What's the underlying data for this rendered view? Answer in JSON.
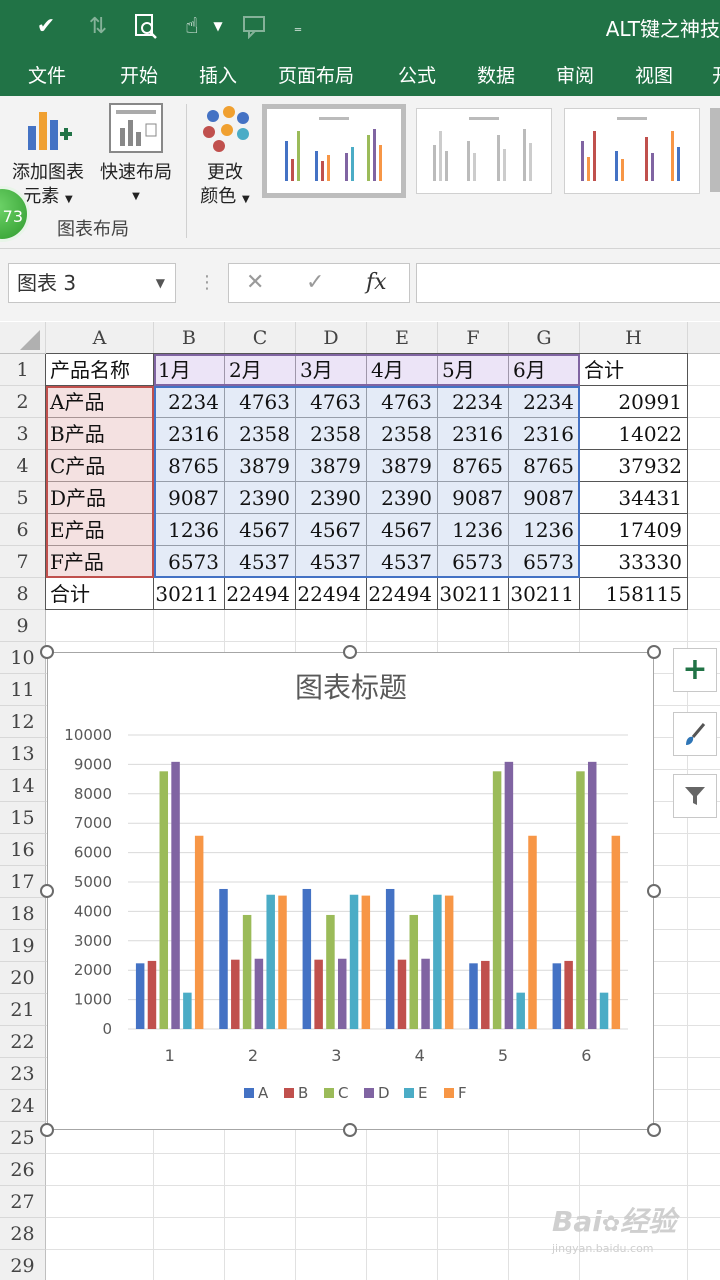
{
  "qat": {
    "title": "ALT键之神技"
  },
  "tabs": [
    "文件",
    "开始",
    "插入",
    "页面布局",
    "公式",
    "数据",
    "审阅",
    "视图",
    "开"
  ],
  "ribbon": {
    "add_element_line1": "添加图表",
    "add_element_line2": "元素",
    "quick_layout": "快速布局",
    "change_color_line1": "更改",
    "change_color_line2": "颜色",
    "group_label": "图表布局",
    "badge": "73"
  },
  "formula_bar": {
    "name_box": "图表 3",
    "fx": "fx",
    "cancel": "✕",
    "enter": "✓"
  },
  "sheet": {
    "columns": [
      "A",
      "B",
      "C",
      "D",
      "E",
      "F",
      "G",
      "H"
    ],
    "rows": [
      "1",
      "2",
      "3",
      "4",
      "5",
      "6",
      "7",
      "8",
      "9",
      "10",
      "11",
      "12",
      "13",
      "14",
      "15",
      "16",
      "17",
      "18",
      "19",
      "20",
      "21",
      "22",
      "23",
      "24",
      "25",
      "26",
      "27",
      "28",
      "29"
    ],
    "header_row": [
      "产品名称",
      "1月",
      "2月",
      "3月",
      "4月",
      "5月",
      "6月",
      "合计"
    ],
    "data_rows": [
      [
        "A产品",
        "2234",
        "4763",
        "4763",
        "4763",
        "2234",
        "2234",
        "20991"
      ],
      [
        "B产品",
        "2316",
        "2358",
        "2358",
        "2358",
        "2316",
        "2316",
        "14022"
      ],
      [
        "C产品",
        "8765",
        "3879",
        "3879",
        "3879",
        "8765",
        "8765",
        "37932"
      ],
      [
        "D产品",
        "9087",
        "2390",
        "2390",
        "2390",
        "9087",
        "9087",
        "34431"
      ],
      [
        "E产品",
        "1236",
        "4567",
        "4567",
        "4567",
        "1236",
        "1236",
        "17409"
      ],
      [
        "F产品",
        "6573",
        "4537",
        "4537",
        "4537",
        "6573",
        "6573",
        "33330"
      ]
    ],
    "total_row": [
      "合计",
      "30211",
      "22494",
      "22494",
      "22494",
      "30211",
      "30211",
      "158115"
    ]
  },
  "chart_data": {
    "type": "bar",
    "title": "图表标题",
    "categories": [
      "1",
      "2",
      "3",
      "4",
      "5",
      "6"
    ],
    "ylim": [
      0,
      10000
    ],
    "yticks": [
      "10000",
      "9000",
      "8000",
      "7000",
      "6000",
      "5000",
      "4000",
      "3000",
      "2000",
      "1000",
      "0"
    ],
    "grid": true,
    "legend": "bottom",
    "series": [
      {
        "name": "A",
        "color": "#4472c4",
        "values": [
          2234,
          4763,
          4763,
          4763,
          2234,
          2234
        ]
      },
      {
        "name": "B",
        "color": "#c0504d",
        "values": [
          2316,
          2358,
          2358,
          2358,
          2316,
          2316
        ]
      },
      {
        "name": "C",
        "color": "#9bbb59",
        "values": [
          8765,
          3879,
          3879,
          3879,
          8765,
          8765
        ]
      },
      {
        "name": "D",
        "color": "#8064a2",
        "values": [
          9087,
          2390,
          2390,
          2390,
          9087,
          9087
        ]
      },
      {
        "name": "E",
        "color": "#4bacc6",
        "values": [
          1236,
          4567,
          4567,
          4567,
          1236,
          1236
        ]
      },
      {
        "name": "F",
        "color": "#f79646",
        "values": [
          6573,
          4537,
          4537,
          4537,
          6573,
          6573
        ]
      }
    ]
  },
  "watermark": {
    "brand": "Bai",
    "brand2": "经验",
    "url": "jingyan.baidu.com"
  },
  "colors": {
    "excel_green": "#217346",
    "ribbon_bg": "#f3f3f3"
  }
}
